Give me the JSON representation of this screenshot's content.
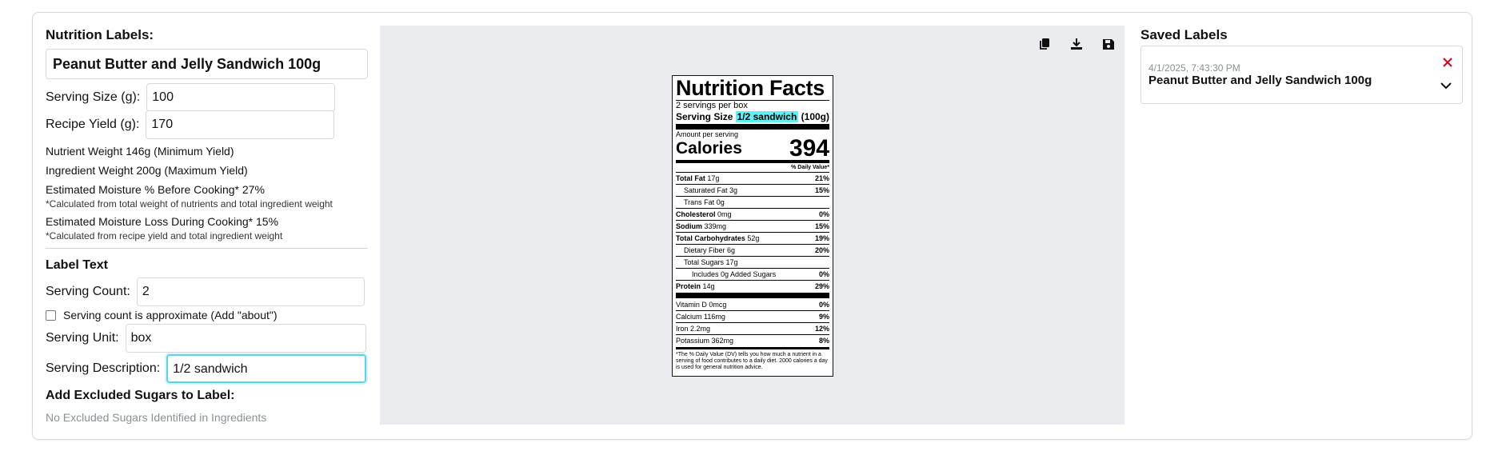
{
  "left": {
    "title": "Nutrition Labels:",
    "recipe_name": "Peanut Butter and Jelly Sandwich 100g",
    "serving_size": {
      "label": "Serving Size (g):",
      "value": "100"
    },
    "recipe_yield": {
      "label": "Recipe Yield (g):",
      "value": "170"
    },
    "stats": {
      "nutrient_weight": "Nutrient Weight 146g (Minimum Yield)",
      "ingredient_weight": "Ingredient Weight 200g (Maximum Yield)",
      "moisture_before": "Estimated Moisture % Before Cooking* 27%",
      "moisture_before_note": "*Calculated from total weight of nutrients and total ingredient weight",
      "moisture_loss": "Estimated Moisture Loss During Cooking* 15%",
      "moisture_loss_note": "*Calculated from recipe yield and total ingredient weight"
    },
    "label_text": {
      "title": "Label Text",
      "serving_count": {
        "label": "Serving Count:",
        "value": "2"
      },
      "approx_checkbox": {
        "label": "Serving count is approximate (Add \"about\")",
        "checked": false
      },
      "serving_unit": {
        "label": "Serving Unit:",
        "value": "box"
      },
      "serving_description": {
        "label": "Serving Description:",
        "value": "1/2 sandwich"
      }
    },
    "excluded_sugars": {
      "title": "Add Excluded Sugars to Label:",
      "empty": "No Excluded Sugars Identified in Ingredients"
    }
  },
  "toolbar": {
    "icons": [
      "copy-icon",
      "download-icon",
      "save-icon"
    ]
  },
  "label": {
    "title": "Nutrition Facts",
    "servings": "2 servings per box",
    "serving_size_label": "Serving Size",
    "serving_size_desc": "1/2 sandwich",
    "serving_size_grams": "(100g)",
    "amount_per_serving": "Amount per serving",
    "calories_label": "Calories",
    "calories": "394",
    "dv_header": "% Daily Value*",
    "nutrients": [
      {
        "name": "Total Fat",
        "amount": "17g",
        "dv": "21%",
        "bold": true,
        "indent": 0
      },
      {
        "name": "Saturated Fat",
        "amount": "3g",
        "dv": "15%",
        "bold": false,
        "indent": 1
      },
      {
        "name": "Trans Fat",
        "amount": "0g",
        "dv": "",
        "bold": false,
        "indent": 1
      },
      {
        "name": "Cholesterol",
        "amount": "0mg",
        "dv": "0%",
        "bold": true,
        "indent": 0
      },
      {
        "name": "Sodium",
        "amount": "339mg",
        "dv": "15%",
        "bold": true,
        "indent": 0
      },
      {
        "name": "Total Carbohydrates",
        "amount": "52g",
        "dv": "19%",
        "bold": true,
        "indent": 0
      },
      {
        "name": "Dietary Fiber",
        "amount": "6g",
        "dv": "20%",
        "bold": false,
        "indent": 1
      },
      {
        "name": "Total Sugars",
        "amount": "17g",
        "dv": "",
        "bold": false,
        "indent": 1
      },
      {
        "name": "Includes 0g Added Sugars",
        "amount": "",
        "dv": "0%",
        "bold": false,
        "indent": 2
      },
      {
        "name": "Protein",
        "amount": "14g",
        "dv": "29%",
        "bold": true,
        "indent": 0
      }
    ],
    "vitamins": [
      {
        "name": "Vitamin D",
        "amount": "0mcg",
        "dv": "0%"
      },
      {
        "name": "Calcium",
        "amount": "116mg",
        "dv": "9%"
      },
      {
        "name": "Iron",
        "amount": "2.2mg",
        "dv": "12%"
      },
      {
        "name": "Potassium",
        "amount": "362mg",
        "dv": "8%"
      }
    ],
    "footnote": "*The % Daily Value (DV) tells you how much a nutrient in a serving of food contributes to a daily diet. 2000 calories a day is used for general nutrition advice.",
    "highlight_color": "#5ff0f5"
  },
  "saved": {
    "title": "Saved Labels",
    "items": [
      {
        "date": "4/1/2025, 7:43:30 PM",
        "name": "Peanut Butter and Jelly Sandwich 100g"
      }
    ],
    "delete_color": "#d0021b"
  },
  "colors": {
    "focus": "#5fd3e6",
    "preview_bg": "#eaebef",
    "muted": "#8a8f96"
  }
}
